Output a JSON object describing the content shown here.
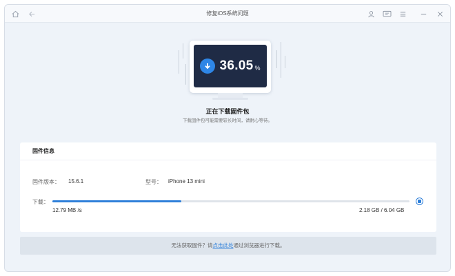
{
  "window": {
    "title": "修复iOS系统问题"
  },
  "titlebar": {
    "icons": [
      "home-icon",
      "back-icon",
      "account-icon",
      "feedback-icon",
      "menu-icon",
      "minimize-icon",
      "close-icon"
    ]
  },
  "download": {
    "percent_value": "36.05",
    "percent_sign": "%",
    "progress": 0.3605,
    "title": "正在下载固件包",
    "subtitle": "下载固件包可能需要较长时间，请耐心等待。"
  },
  "firmware": {
    "section_title": "固件信息",
    "version_label": "固件版本：",
    "version_value": "15.6.1",
    "model_label": "型号：",
    "model_value": "iPhone 13 mini",
    "download_label": "下载：",
    "speed": "12.79 MB /s",
    "size": "2.18 GB / 6.04 GB"
  },
  "footer": {
    "prefix": "无法获取固件？请",
    "link": "点击此处",
    "suffix": "通过浏览器进行下载。"
  },
  "colors": {
    "accent": "#2e7fd9",
    "screen": "#1f2b45"
  }
}
